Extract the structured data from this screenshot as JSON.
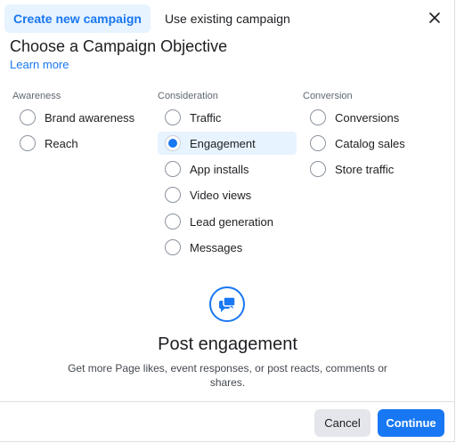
{
  "tabs": [
    {
      "label": "Create new campaign",
      "active": true
    },
    {
      "label": "Use existing campaign",
      "active": false
    }
  ],
  "heading": "Choose a Campaign Objective",
  "learn_more": "Learn more",
  "columns": [
    {
      "title": "Awareness",
      "options": [
        "Brand awareness",
        "Reach"
      ]
    },
    {
      "title": "Consideration",
      "options": [
        "Traffic",
        "Engagement",
        "App installs",
        "Video views",
        "Lead generation",
        "Messages"
      ]
    },
    {
      "title": "Conversion",
      "options": [
        "Conversions",
        "Catalog sales",
        "Store traffic"
      ]
    }
  ],
  "selected_option": "Engagement",
  "feature": {
    "icon": "chat-bubbles-icon",
    "title": "Post engagement",
    "description": "Get more Page likes, event responses, or post reacts, comments or shares."
  },
  "buttons": {
    "cancel": "Cancel",
    "continue": "Continue"
  },
  "colors": {
    "accent": "#1877f2",
    "selected_bg": "#e7f3ff",
    "secondary_button": "#e4e6eb"
  }
}
